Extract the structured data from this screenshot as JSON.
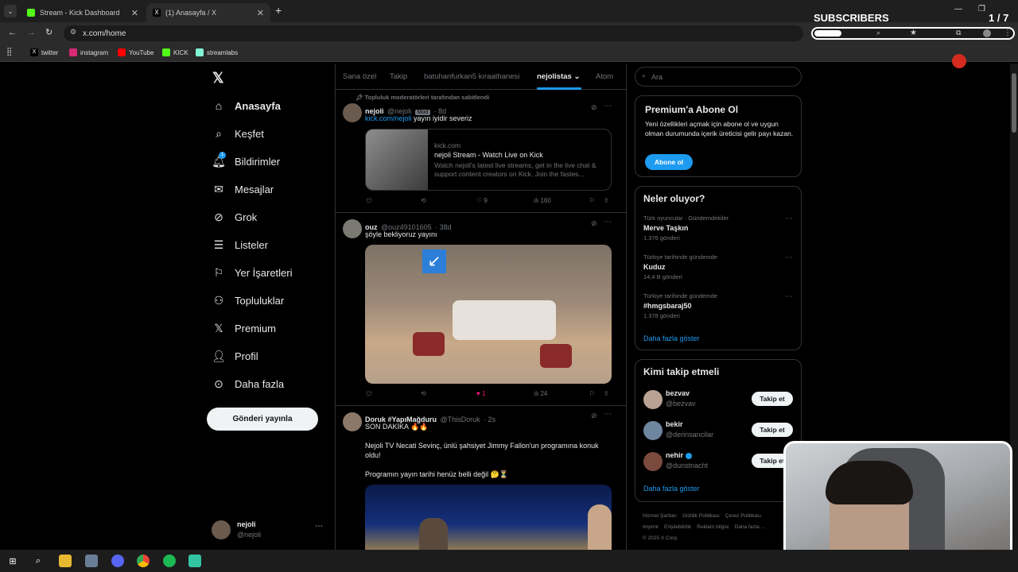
{
  "browser": {
    "tabs": [
      {
        "label": "Stream - Kick Dashboard",
        "active": false
      },
      {
        "label": "(1) Anasayfa / X",
        "active": true
      }
    ],
    "url": "x.com/home",
    "bookmarks": [
      "twitter",
      "instagram",
      "YouTube",
      "KICK",
      "streamlabs"
    ]
  },
  "overlay": {
    "subscribers_label": "SUBSCRIBERS",
    "subscribers_count": "1 / 7"
  },
  "nav": {
    "items": [
      "Anasayfa",
      "Keşfet",
      "Bildirimler",
      "Mesajlar",
      "Grok",
      "Listeler",
      "Yer İşaretleri",
      "Topluluklar",
      "Premium",
      "Profil",
      "Daha fazla"
    ],
    "notification_badge": "1",
    "post_button": "Gönderi yayınla",
    "account": {
      "name": "nejoli",
      "handle": "@nejoli"
    }
  },
  "feed_tabs": [
    "Sana özel",
    "Takip",
    "batuhanfurkan5 kıraathanesi",
    "nejolistas",
    "Atom"
  ],
  "tweets": [
    {
      "pinned_label": "Topluluk moderatörleri tarafından sabitlendi",
      "name": "nejoli",
      "handle": "@nejoli",
      "badge": "Mod",
      "time": "· 8d",
      "text_link": "kick.com/nejoli",
      "text": " yayın iyidir severiz",
      "card": {
        "domain": "kick.com",
        "title": "nejoli Stream - Watch Live on Kick",
        "desc": "Watch nejoli's latest live streams, get in the live chat & support content creators on Kick. Join the fastes..."
      },
      "likes": "9",
      "views": "160"
    },
    {
      "name": "ouz",
      "handle": "@ouz49101605",
      "time": "· 38d",
      "text": "şöyle bekliyoruz yayını",
      "likes": "1",
      "views": "24"
    },
    {
      "name": "Doruk #YapıMağduru",
      "handle": "@ThisDoruk",
      "time": "· 2s",
      "line1": "SON DAKİKA 🔥🔥",
      "line2": "Nejoli TV Necati Sevinç, ünlü şahsiyet Jimmy Fallon'un programına konuk oldu!",
      "line3": "Programın yayın tarihi henüz belli değil 🤔⏳"
    }
  ],
  "search": {
    "placeholder": "Ara"
  },
  "premium": {
    "title": "Premium'a Abone Ol",
    "text": "Yeni özellikleri açmak için abone ol ve uygun olman durumunda içerik üreticisi gelir payı kazan.",
    "button": "Abone ol"
  },
  "trends": {
    "title": "Neler oluyor?",
    "items": [
      {
        "context": "Türk oyuncular · Gündemdekiler",
        "name": "Merve Taşkın",
        "count": "1.376 gönderi"
      },
      {
        "context": "Türkiye tarihinde gündemde",
        "name": "Kuduz",
        "count": "14,4 B gönderi"
      },
      {
        "context": "Türkiye tarihinde gündemde",
        "name": "#hmgsbaraj50",
        "count": "1.378 gönderi"
      }
    ],
    "more": "Daha fazla göster"
  },
  "who_to_follow": {
    "title": "Kimi takip etmeli",
    "items": [
      {
        "name": "bezvav",
        "handle": "@bezvav",
        "button": "Takip et"
      },
      {
        "name": "bekir",
        "handle": "@derinsancilar",
        "button": "Takip et"
      },
      {
        "name": "nehir",
        "handle": "@dunstnacht",
        "button": "Takip et"
      }
    ],
    "more": "Daha fazla göster"
  },
  "footer": {
    "links": [
      "Hizmet Şartları",
      "Gizlilik Politikası",
      "Çerez Politikası",
      "Imprint",
      "Erişilebilirlik",
      "Reklam bilgisi",
      "Daha fazla ..."
    ],
    "copyright": "© 2025 X Corp."
  },
  "colors": {
    "accent": "#1d9bf0",
    "kick": "#53fc18",
    "like": "#f91880"
  }
}
